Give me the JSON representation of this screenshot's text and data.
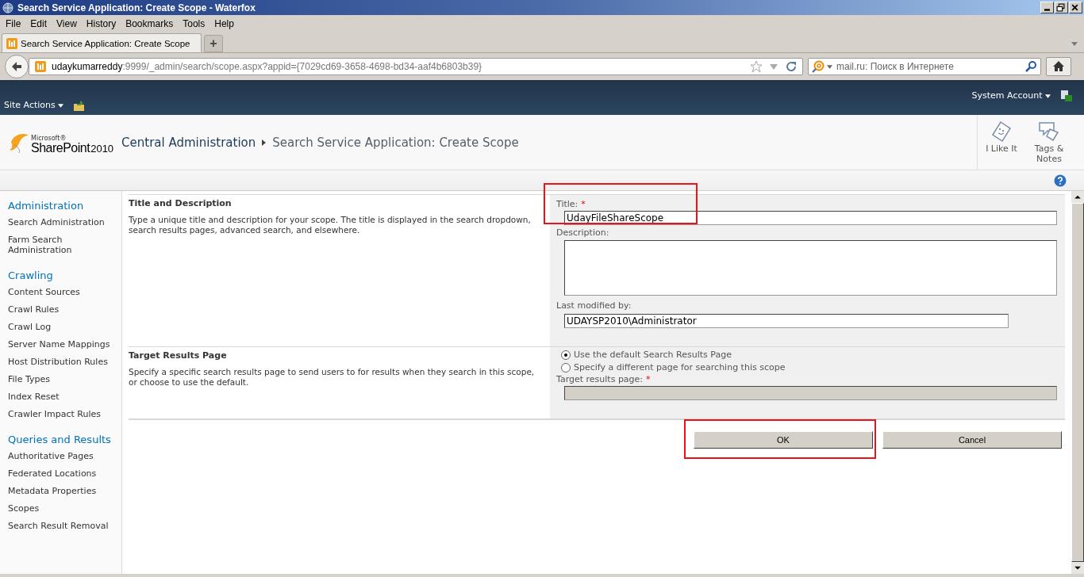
{
  "window": {
    "title": "Search Service Application: Create Scope - Waterfox"
  },
  "menu": [
    "File",
    "Edit",
    "View",
    "History",
    "Bookmarks",
    "Tools",
    "Help"
  ],
  "tabs": [
    {
      "label": "Search Service Application: Create Scope",
      "selected": true
    }
  ],
  "new_tab": "+",
  "address": {
    "host": "udaykumarreddy",
    "path": ":9999/_admin/search/scope.aspx?appid={7029cd69-3658-4698-bd34-aaf4b6803b39}"
  },
  "search": {
    "placeholder": "mail.ru: Поиск в Интернете"
  },
  "ribbon": {
    "site_actions": "Site Actions",
    "user": "System Account"
  },
  "header": {
    "brand_small": "Microsoft®",
    "brand": "SharePoint",
    "version": "2010",
    "breadcrumb": [
      "Central Administration",
      "Search Service Application: Create Scope"
    ],
    "actions": [
      {
        "label": "I Like It",
        "kind": "like"
      },
      {
        "label": "Tags & Notes",
        "kind": "tags"
      }
    ]
  },
  "sidebar": [
    {
      "heading": "Administration",
      "items": [
        "Search Administration",
        "Farm Search Administration"
      ]
    },
    {
      "heading": "Crawling",
      "items": [
        "Content Sources",
        "Crawl Rules",
        "Crawl Log",
        "Server Name Mappings",
        "Host Distribution Rules",
        "File Types",
        "Index Reset",
        "Crawler Impact Rules"
      ]
    },
    {
      "heading": "Queries and Results",
      "items": [
        "Authoritative Pages",
        "Federated Locations",
        "Metadata Properties",
        "Scopes",
        "Search Result Removal"
      ]
    }
  ],
  "sections": [
    {
      "title": "Title and Description",
      "description": "Type a unique title and description for your scope. The title is displayed in the search dropdown, search results pages, advanced search, and elsewhere.",
      "controls": [
        {
          "kind": "text",
          "label": "Title:",
          "required_mark": "*",
          "value": "UdayFileShareScope",
          "highlighted": true,
          "disabled": false
        },
        {
          "kind": "textarea",
          "label": "Description:"
        },
        {
          "kind": "short_text",
          "label": "Last modified by:",
          "value": "UDAYSP2010\\Administrator",
          "highlighted": false,
          "disabled": false
        }
      ]
    },
    {
      "title": "Target Results Page",
      "description": "Specify a specific search results page to send users to for results when they search in this scope, or choose to use the default.",
      "controls": [
        {
          "kind": "radio",
          "label": "Use the default Search Results Page",
          "selected": true
        },
        {
          "kind": "radio",
          "label": "Specify a different page for searching this scope",
          "selected": false
        },
        {
          "kind": "text",
          "label": "Target results page:",
          "required_mark": "*",
          "highlighted": false,
          "disabled": true
        }
      ]
    }
  ],
  "buttons": [
    {
      "label": "OK",
      "highlighted": true
    },
    {
      "label": "Cancel",
      "highlighted": false
    }
  ]
}
